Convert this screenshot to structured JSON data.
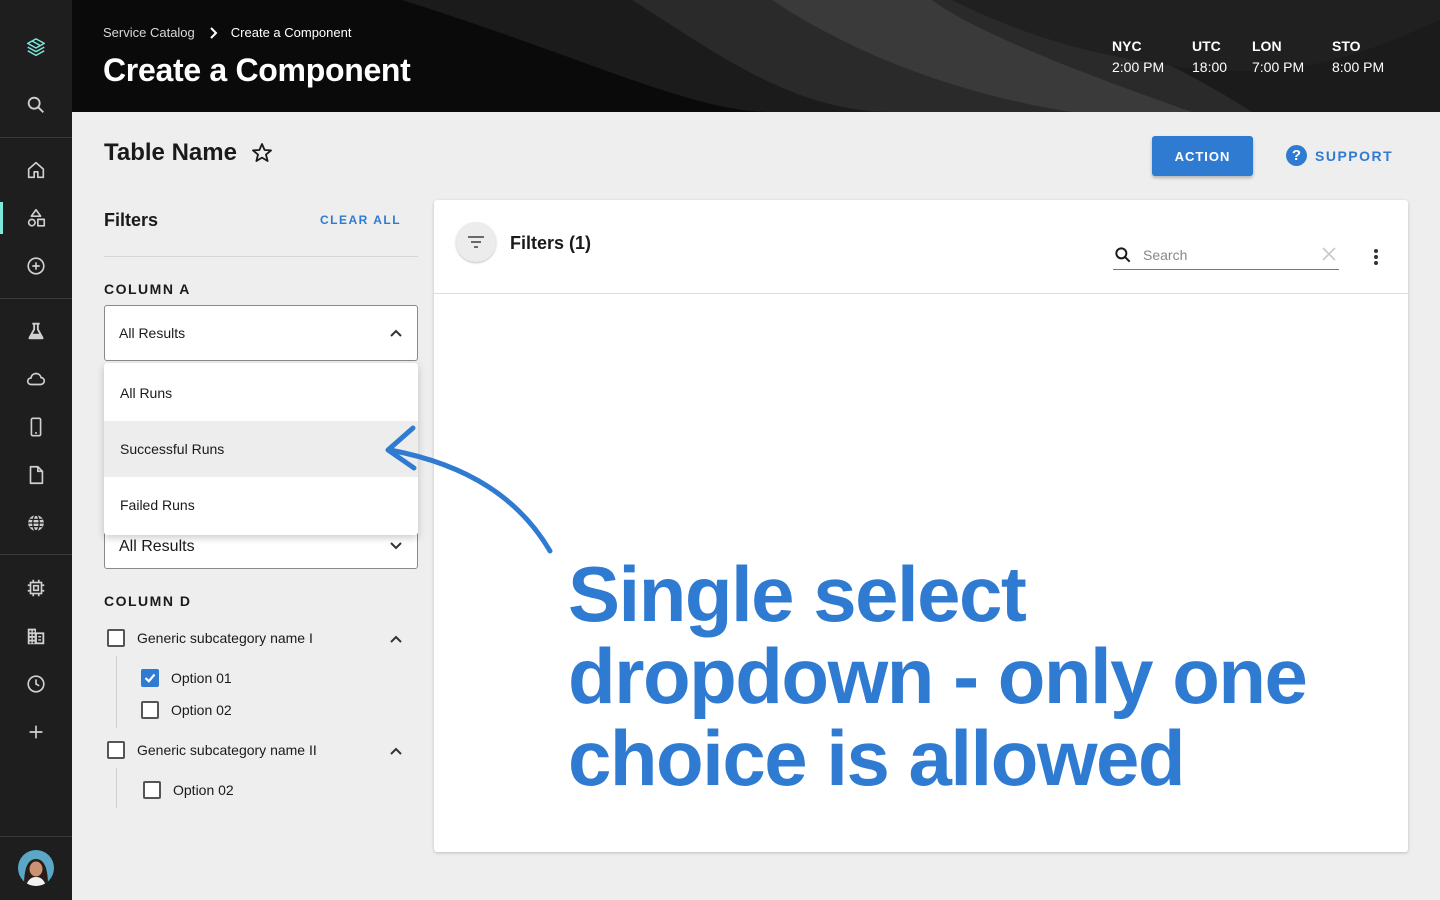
{
  "breadcrumb": {
    "parent": "Service Catalog",
    "current": "Create a Component"
  },
  "header": {
    "title": "Create a Component"
  },
  "clocks": [
    {
      "zone": "NYC",
      "time": "2:00 PM"
    },
    {
      "zone": "UTC",
      "time": "18:00"
    },
    {
      "zone": "LON",
      "time": "7:00 PM"
    },
    {
      "zone": "STO",
      "time": "8:00 PM"
    }
  ],
  "page": {
    "table_name": "Table Name",
    "action_label": "ACTION",
    "support_label": "SUPPORT",
    "support_icon": "?"
  },
  "filters": {
    "title": "Filters",
    "clear_all": "CLEAR ALL",
    "column_a": {
      "label": "COLUMN A",
      "selected": "All Results",
      "options": [
        "All Runs",
        "Successful Runs",
        "Failed Runs"
      ],
      "highlighted": "Successful Runs"
    },
    "second_select": {
      "selected": "All Results"
    },
    "column_d": {
      "label": "COLUMN D",
      "groups": [
        {
          "name": "Generic subcategory name I",
          "checked": false,
          "options": [
            {
              "label": "Option 01",
              "checked": true
            },
            {
              "label": "Option 02",
              "checked": false
            }
          ]
        },
        {
          "name": "Generic subcategory name II",
          "checked": false,
          "options": [
            {
              "label": "Option 02",
              "checked": false
            }
          ]
        }
      ]
    }
  },
  "card": {
    "filters_label": "Filters (1)",
    "search_placeholder": "Search"
  },
  "annotation": {
    "text": "Single select dropdown - only one choice is allowed"
  },
  "colors": {
    "accent": "#2f7bd2",
    "rail": "#1e1e1e",
    "rail_active": "#7ee8da",
    "header": "#0a0a0a"
  },
  "icons": {
    "rail": [
      "logo-icon",
      "search-icon",
      "home-icon",
      "shapes-icon",
      "add-circle-icon",
      "flask-icon",
      "cloud-icon",
      "phone-icon",
      "document-icon",
      "globe-icon",
      "chip-icon",
      "building-icon",
      "clock-icon",
      "plus-icon"
    ]
  }
}
